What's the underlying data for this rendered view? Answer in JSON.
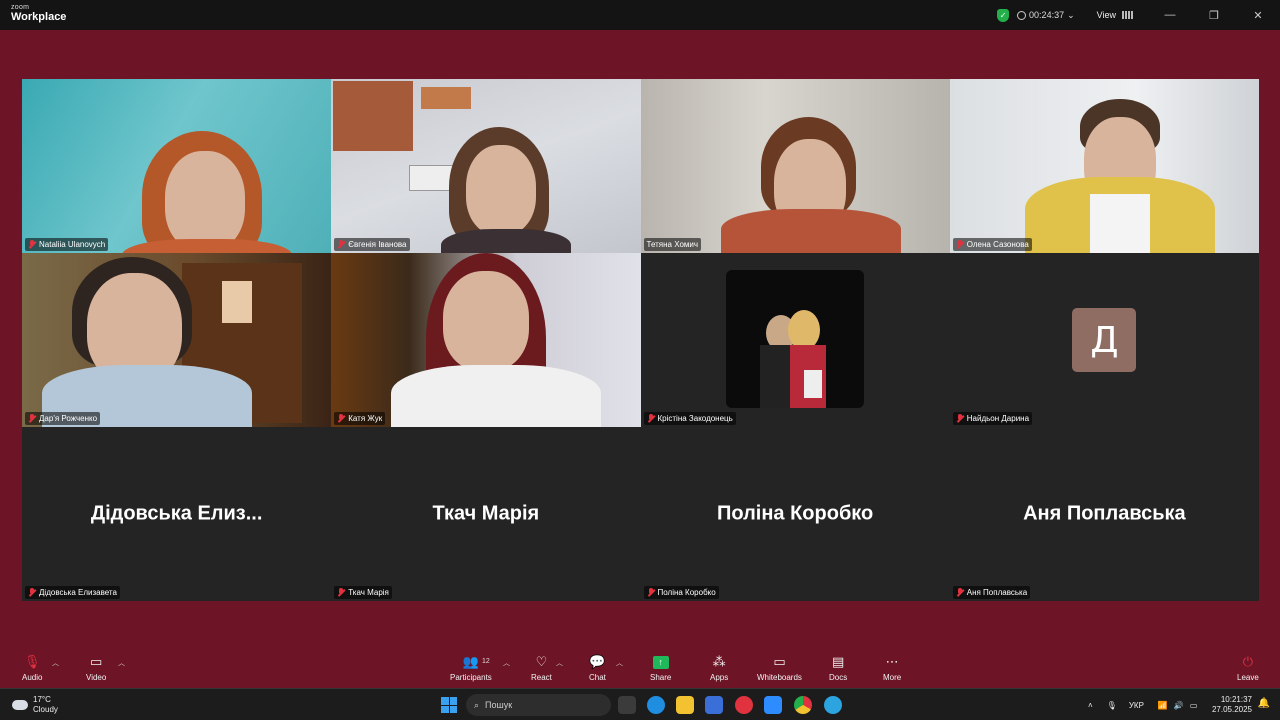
{
  "window": {
    "logo_small": "zoom",
    "logo_main": "Workplace",
    "timer": "00:24:37",
    "view_label": "View"
  },
  "tiles": [
    {
      "name": "Nataliia Ulanovych",
      "muted": true,
      "type": "video"
    },
    {
      "name": "Євгенія Іванова",
      "muted": true,
      "type": "video"
    },
    {
      "name": "Тетяна Хомич",
      "muted": false,
      "type": "video",
      "active": true
    },
    {
      "name": "Олена Сазонова",
      "muted": true,
      "type": "video"
    },
    {
      "name": "Дар'я Рожченко",
      "muted": true,
      "type": "video"
    },
    {
      "name": "Катя Жук",
      "muted": true,
      "type": "video"
    },
    {
      "name": "Крістіна Закодонець",
      "muted": true,
      "type": "photo"
    },
    {
      "name": "Найдьон Дарина",
      "muted": true,
      "type": "avatar",
      "avatar_letter": "Д"
    },
    {
      "name": "Дідовська Елизавета",
      "display": "Дідовська  Елиз...",
      "muted": true,
      "type": "name"
    },
    {
      "name": "Ткач Марія",
      "display": "Ткач Марія",
      "muted": true,
      "type": "name"
    },
    {
      "name": "Поліна Коробко",
      "display": "Поліна Коробко",
      "muted": true,
      "type": "name"
    },
    {
      "name": "Аня Поплавська",
      "display": "Аня Поплавська",
      "muted": true,
      "type": "name"
    }
  ],
  "controls": {
    "audio": "Audio",
    "video": "Video",
    "participants": "Participants",
    "participants_count": "12",
    "react": "React",
    "chat": "Chat",
    "share": "Share",
    "apps": "Apps",
    "whiteboards": "Whiteboards",
    "docs": "Docs",
    "more": "More",
    "leave": "Leave"
  },
  "taskbar": {
    "temperature": "17°C",
    "weather": "Cloudy",
    "search_placeholder": "Пошук",
    "language": "УКР",
    "time": "10:21:37",
    "date": "27.05.2025"
  },
  "colors": {
    "background": "#6d1426",
    "active_speaker": "#2fd37a",
    "muted": "#e0323f",
    "share": "#1fb85a"
  }
}
